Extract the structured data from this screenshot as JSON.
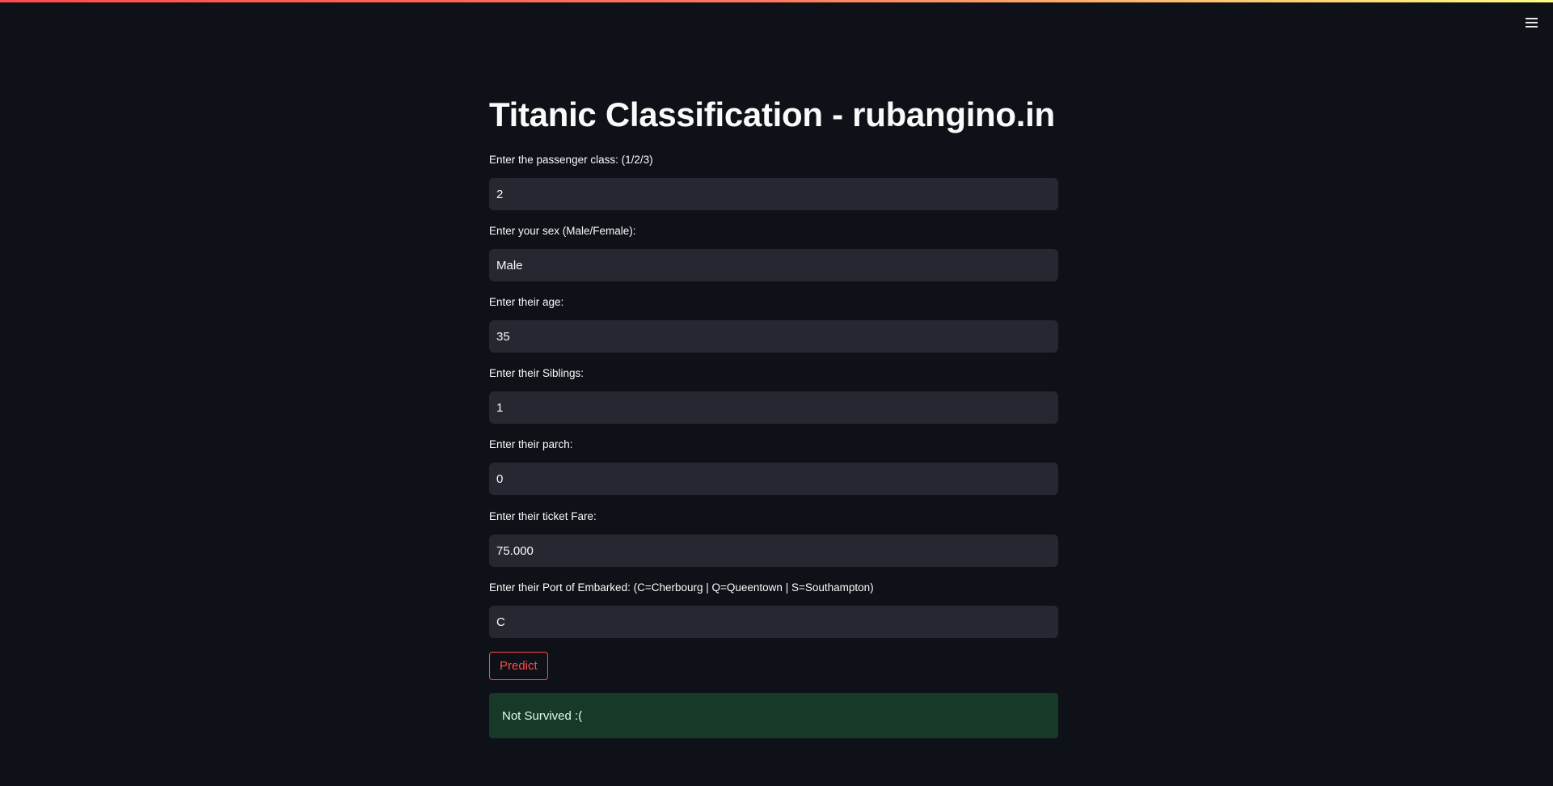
{
  "app": {
    "title": "Titanic Classification - rubangino.in",
    "theme_colors": {
      "background": "#0e1117",
      "input_background": "#262730",
      "accent": "#ff4b4b",
      "success_background": "#173928",
      "success_text": "#dffde9"
    }
  },
  "header": {
    "menu_icon": "hamburger-menu-icon"
  },
  "form": {
    "fields": [
      {
        "label": "Enter the passenger class: (1/2/3)",
        "value": "2"
      },
      {
        "label": "Enter your sex (Male/Female):",
        "value": "Male"
      },
      {
        "label": "Enter their age:",
        "value": "35"
      },
      {
        "label": "Enter their Siblings:",
        "value": "1"
      },
      {
        "label": "Enter their parch:",
        "value": "0"
      },
      {
        "label": "Enter their ticket Fare:",
        "value": "75.000"
      },
      {
        "label": "Enter their Port of Embarked: (C=Cherbourg | Q=Queentown | S=Southampton)",
        "value": "C"
      }
    ],
    "predict_label": "Predict"
  },
  "result": {
    "message": "Not Survived :("
  }
}
